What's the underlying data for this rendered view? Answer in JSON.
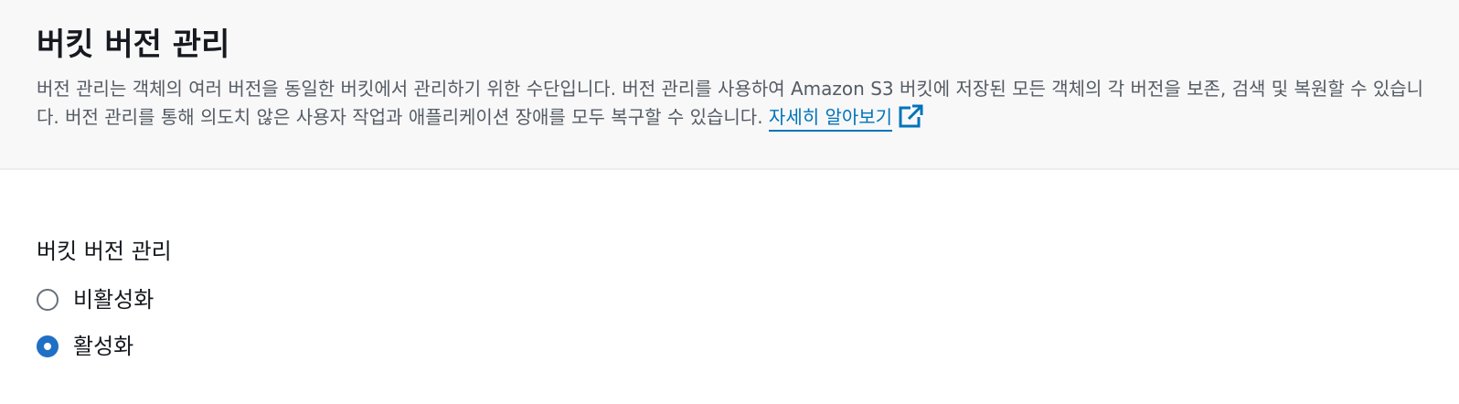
{
  "header": {
    "title": "버킷 버전 관리",
    "description": "버전 관리는 객체의 여러 버전을 동일한 버킷에서 관리하기 위한 수단입니다. 버전 관리를 사용하여 Amazon S3 버킷에 저장된 모든 객체의 각 버전을 보존, 검색 및 복원할 수 있습니다. 버전 관리를 통해 의도치 않은 사용자 작업과 애플리케이션 장애를 모두 복구할 수 있습니다.",
    "learn_more_label": "자세히 알아보기",
    "external_icon": "external-link-icon"
  },
  "versioning": {
    "label": "버킷 버전 관리",
    "options": [
      {
        "label": "비활성화",
        "selected": false
      },
      {
        "label": "활성화",
        "selected": true
      }
    ]
  },
  "colors": {
    "link": "#0073bb",
    "radio_selected": "#1f6fc5",
    "header_bg": "#f8f8f8",
    "description_text": "#545b64"
  }
}
